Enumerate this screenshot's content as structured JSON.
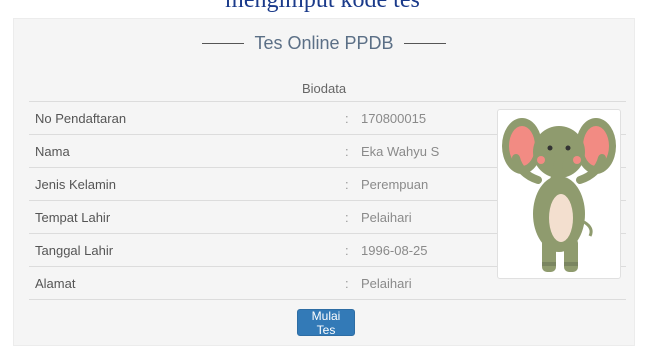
{
  "top_caption": "mengimput kode tes",
  "panel": {
    "title": "Tes Online PPDB",
    "subtitle": "Biodata"
  },
  "biodata": [
    {
      "label": "No Pendaftaran",
      "value": "170800015"
    },
    {
      "label": "Nama",
      "value": "Eka Wahyu S"
    },
    {
      "label": "Jenis Kelamin",
      "value": "Perempuan"
    },
    {
      "label": "Tempat Lahir",
      "value": "Pelaihari"
    },
    {
      "label": "Tanggal Lahir",
      "value": "1996-08-25"
    },
    {
      "label": "Alamat",
      "value": "Pelaihari"
    }
  ],
  "separator": ":",
  "photo": {
    "icon": "elephant-avatar-icon"
  },
  "actions": {
    "start_label": "Mulai Tes"
  },
  "colors": {
    "primary_button": "#337ab7",
    "title_text": "#5b6f86",
    "caption_text": "#1a3a8a"
  }
}
